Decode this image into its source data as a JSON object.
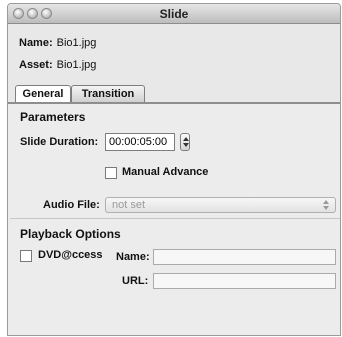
{
  "window": {
    "title": "Slide"
  },
  "info": {
    "name_label": "Name:",
    "name_value": "Bio1.jpg",
    "asset_label": "Asset:",
    "asset_value": "Bio1.jpg"
  },
  "tabs": [
    {
      "label": "General",
      "active": true
    },
    {
      "label": "Transition",
      "active": false
    }
  ],
  "parameters": {
    "section_title": "Parameters",
    "slide_duration_label": "Slide Duration:",
    "slide_duration_value": "00:00:05:00",
    "manual_advance_label": "Manual Advance",
    "manual_advance_checked": false,
    "audio_file_label": "Audio File:",
    "audio_file_value": "not set"
  },
  "playback": {
    "section_title": "Playback Options",
    "dvd_access_label": "DVD@ccess",
    "dvd_access_checked": false,
    "name_label": "Name:",
    "name_value": "",
    "url_label": "URL:",
    "url_value": ""
  }
}
